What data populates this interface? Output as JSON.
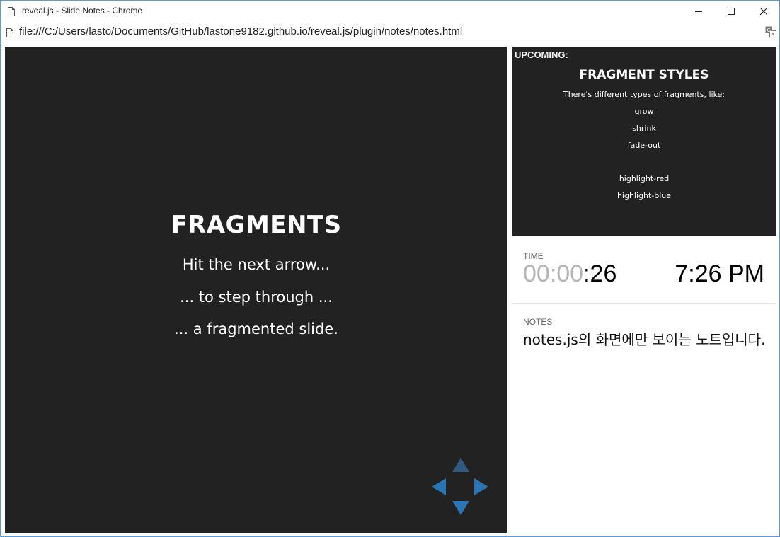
{
  "window": {
    "title": "reveal.js - Slide Notes - Chrome"
  },
  "address_bar": {
    "url": "file:///C:/Users/lasto/Documents/GitHub/lastone9182.github.io/reveal.js/plugin/notes/notes.html"
  },
  "current_slide": {
    "heading": "FRAGMENTS",
    "lines": [
      "Hit the next arrow...",
      "... to step through ...",
      "... a fragmented slide."
    ],
    "controls": {
      "up_enabled": false,
      "left_enabled": true,
      "right_enabled": true,
      "down_enabled": true
    }
  },
  "upcoming_slide": {
    "label": "UPCOMING:",
    "heading": "FRAGMENT STYLES",
    "lines": [
      "There's different types of fragments, like:",
      "grow",
      "shrink",
      "fade-out",
      "highlight-red",
      "highlight-blue"
    ]
  },
  "time": {
    "label": "TIME",
    "timer_faded": "00:00",
    "timer_active": ":26",
    "clock": "7:26 PM"
  },
  "notes": {
    "label": "NOTES",
    "text": "notes.js의 화면에만 보이는 노트입니다."
  },
  "colors": {
    "slide_bg": "#222222",
    "control_arrow": "#2a76b5",
    "control_arrow_disabled": "#2f5a7e",
    "window_border": "#5b9bd5"
  }
}
